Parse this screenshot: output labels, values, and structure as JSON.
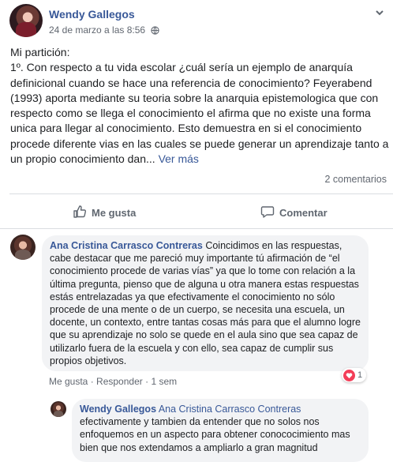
{
  "post": {
    "author": "Wendy Gallegos",
    "timestamp": "24 de marzo a las 8:56",
    "audience_icon": "globe-icon",
    "options_icon": "chevron-down-icon",
    "body_heading": "Mi partición:",
    "body_text": "1º. Con respecto a tu vida escolar ¿cuál sería un ejemplo de anarquía definicional cuando se hace una referencia de conocimiento? Feyerabend (1993) aporta mediante su teoria sobre la anarquia epistemologica que con respecto como se llega el conocimiento el afirma que no existe una forma unica para llegar al conocimiento. Esto demuestra en si el conocimiento procede diferente vias en las cuales se puede generar un aprendizaje tanto a un propio conocimiento dan...",
    "see_more": "Ver más",
    "comment_count": "2 comentarios"
  },
  "actions": {
    "like_label": "Me gusta",
    "like_icon": "thumbs-up-icon",
    "comment_label": "Comentar",
    "comment_icon": "speech-bubble-icon"
  },
  "comments": [
    {
      "author": "Ana Cristina Carrasco Contreras",
      "text": "Coincidimos en las respuestas, cabe destacar que me pareció muy importante tú afirmación de “el conocimiento procede de varias vías” ya que lo tome con relación a la última pregunta, pienso que de alguna u otra manera estas respuestas estás entrelazadas ya que efectivamente el conocimiento no sólo procede de una mente o de un cuerpo, se necesita una escuela, un docente, un contexto, entre tantas cosas más para que el alumno logre que su aprendizaje no solo se quede en el aula sino que sea capaz de utilizarlo fuera de la escuela y con ello, sea capaz de cumplir sus propios objetivos.",
      "like_label": "Me gusta",
      "reply_label": "Responder",
      "separator": "·",
      "age": "1 sem",
      "reaction_icon": "love-heart-icon",
      "reaction_count": "1"
    },
    {
      "author": "Wendy Gallegos",
      "mention": "Ana Cristina Carrasco Contreras",
      "text": "efectivamente y tambien da entender que no solos nos enfoquemos en un aspecto para obtener conococimiento mas bien que nos extendamos a ampliarlo a gran magnitud"
    }
  ],
  "colors": {
    "link": "#385898",
    "meta_text": "#616770",
    "bubble_bg": "#f2f3f5",
    "love_red": "#f33e58"
  }
}
